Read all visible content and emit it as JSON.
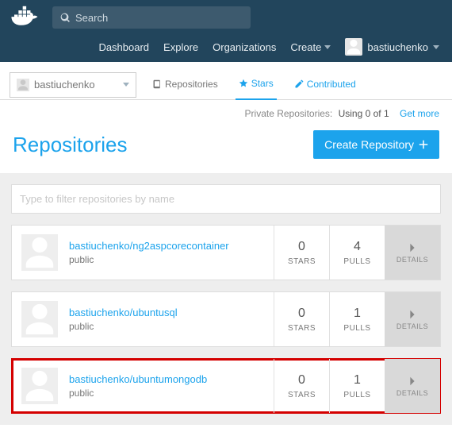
{
  "header": {
    "search_placeholder": "Search",
    "nav": {
      "dashboard": "Dashboard",
      "explore": "Explore",
      "organizations": "Organizations",
      "create": "Create"
    },
    "username": "bastiuchenko"
  },
  "subbar": {
    "owner": "bastiuchenko",
    "tabs": {
      "repositories": "Repositories",
      "stars": "Stars",
      "contributed": "Contributed"
    }
  },
  "quota": {
    "label": "Private Repositories:",
    "value": "Using 0 of 1",
    "getmore": "Get more"
  },
  "main": {
    "title": "Repositories",
    "create_button": "Create Repository",
    "filter_placeholder": "Type to filter repositories by name"
  },
  "stat_labels": {
    "stars": "STARS",
    "pulls": "PULLS",
    "details": "DETAILS"
  },
  "repos": [
    {
      "name": "bastiuchenko/ng2aspcorecontainer",
      "visibility": "public",
      "stars": "0",
      "pulls": "4"
    },
    {
      "name": "bastiuchenko/ubuntusql",
      "visibility": "public",
      "stars": "0",
      "pulls": "1"
    },
    {
      "name": "bastiuchenko/ubuntumongodb",
      "visibility": "public",
      "stars": "0",
      "pulls": "1"
    }
  ]
}
